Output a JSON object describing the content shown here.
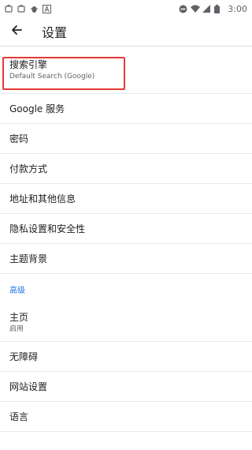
{
  "status_bar": {
    "time": "3:00",
    "left_icons": [
      "app-icon",
      "app-icon",
      "bug-icon",
      "a-icon"
    ],
    "right_icons": [
      "minus-circle-icon",
      "wifi-icon",
      "signal-icon",
      "battery-icon"
    ]
  },
  "appbar": {
    "back_icon": "arrow-left-icon",
    "title": "设置"
  },
  "items": {
    "search_engine": {
      "title": "搜索引擎",
      "subtitle": "Default Search (Google)"
    },
    "google_services": {
      "title": "Google 服务"
    },
    "passwords": {
      "title": "密码"
    },
    "payment": {
      "title": "付款方式"
    },
    "addresses": {
      "title": "地址和其他信息"
    },
    "privacy": {
      "title": "隐私设置和安全性"
    },
    "themes": {
      "title": "主题背景"
    }
  },
  "advanced_header": "高级",
  "advanced_items": {
    "homepage": {
      "title": "主页",
      "subtitle": "启用"
    },
    "accessibility": {
      "title": "无障碍"
    },
    "site_settings": {
      "title": "网站设置"
    },
    "languages": {
      "title": "语言"
    }
  },
  "colors": {
    "accent": "#1a73e8",
    "highlight": "#e53935"
  }
}
